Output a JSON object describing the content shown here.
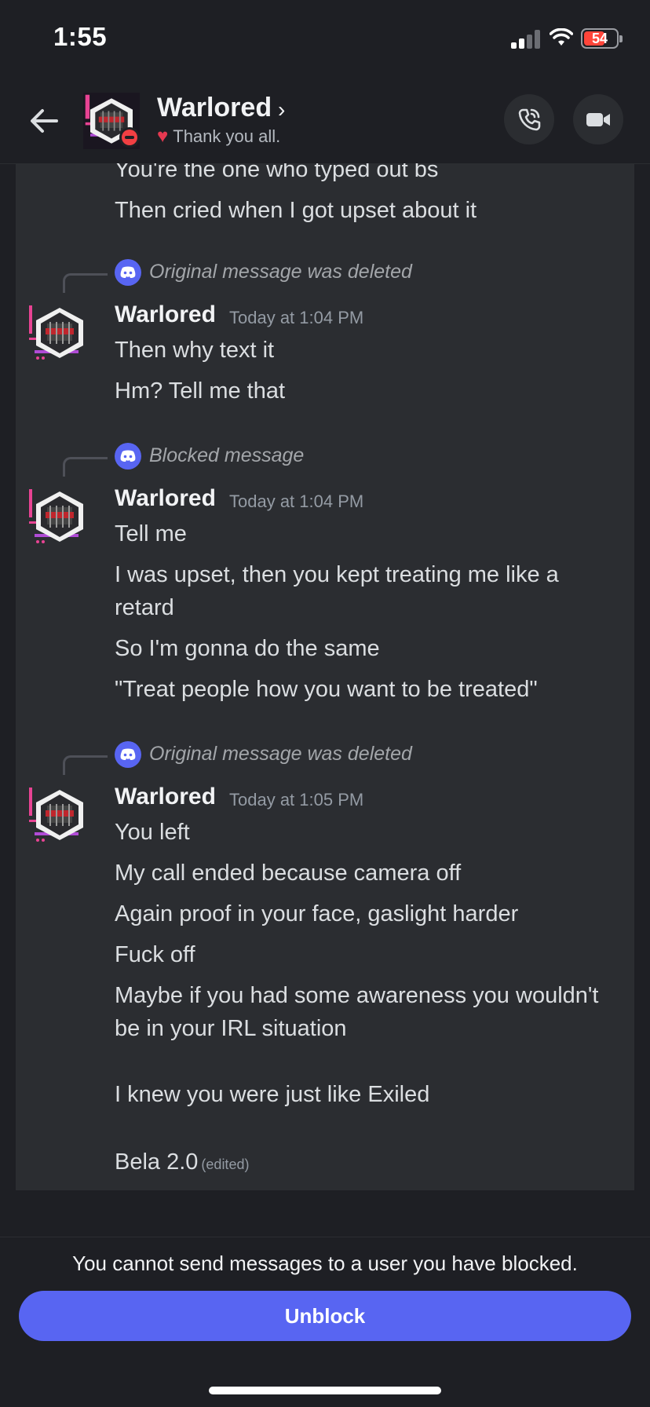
{
  "status_bar": {
    "time": "1:55",
    "battery": "54"
  },
  "header": {
    "name": "Warlored",
    "custom_status": "Thank you all.",
    "call_icon": "phone-call-icon",
    "video_icon": "video-camera-icon"
  },
  "messages": {
    "prev_lines": [
      "You're the one who typed out bs",
      "Then cried when I got upset about it"
    ],
    "group1": {
      "reply": "Original message was deleted",
      "author": "Warlored",
      "timestamp": "Today at 1:04 PM",
      "lines": [
        "Then why text it",
        "Hm? Tell me that"
      ]
    },
    "group2": {
      "reply": "Blocked message",
      "author": "Warlored",
      "timestamp": "Today at 1:04 PM",
      "lines": [
        "Tell me",
        "I was upset, then you kept treating me like a",
        "retard",
        "So I'm gonna do the same",
        "\"Treat people how you want to be treated\""
      ]
    },
    "group3": {
      "reply": "Original message was deleted",
      "author": "Warlored",
      "timestamp": "Today at 1:05 PM",
      "lines": [
        "You left",
        "My call ended because camera off",
        "Again proof in your face, gaslight harder",
        "Fuck off",
        "Maybe if you had some awareness you wouldn't",
        "be in your IRL situation",
        "I knew you were just like Exiled",
        "Bela 2.0"
      ],
      "edited": "(edited)"
    }
  },
  "footer": {
    "blocked_notice": "You cannot send messages to a user you have blocked.",
    "unblock_label": "Unblock"
  },
  "colors": {
    "accent": "#5865f2",
    "background": "#1e1f24",
    "panel": "#2b2d31",
    "dnd": "#f23f43"
  }
}
